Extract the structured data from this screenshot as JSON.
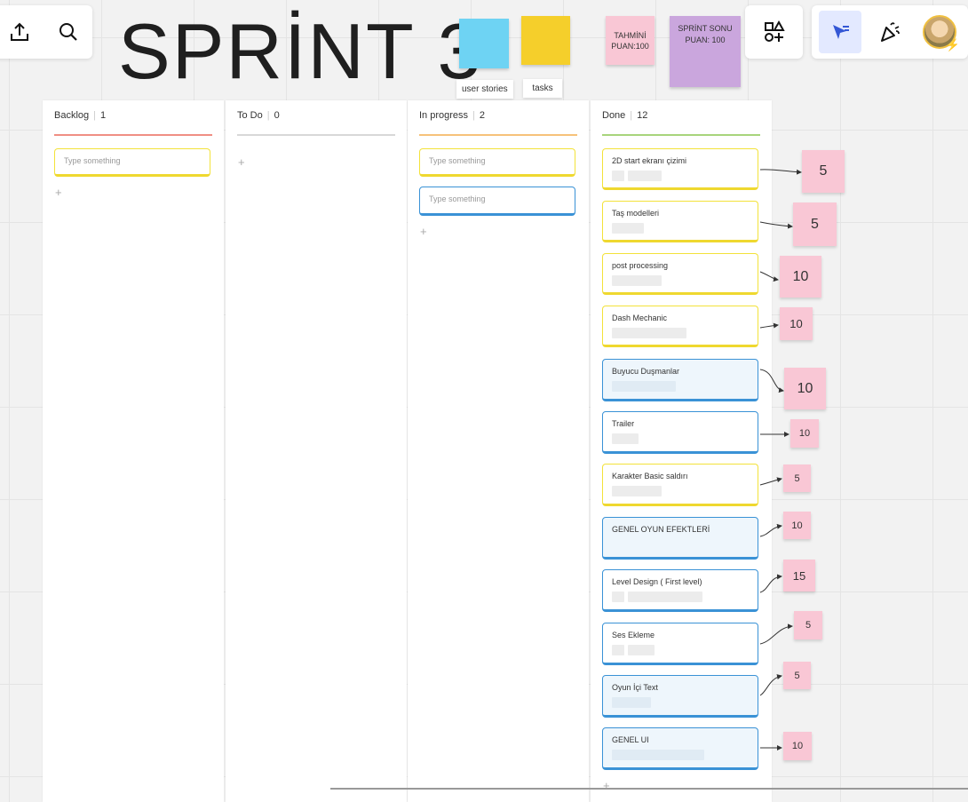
{
  "title": "SPRİNT 3",
  "legend": {
    "user_stories": "user stories",
    "tasks": "tasks"
  },
  "score_notes": {
    "estimated": "TAHMİNİ PUAN:100",
    "sprint_end": "SPRİNT SONU PUAN: 100"
  },
  "columns": [
    {
      "name": "Backlog",
      "count": "1",
      "cards": [
        {
          "title": "Type something"
        }
      ]
    },
    {
      "name": "To Do",
      "count": "0",
      "cards": []
    },
    {
      "name": "In progress",
      "count": "2",
      "cards": [
        {
          "title": "Type something"
        },
        {
          "title": "Type something"
        }
      ]
    },
    {
      "name": "Done",
      "count": "12",
      "cards": [
        {
          "title": "2D start ekranı çizimi",
          "points": "5"
        },
        {
          "title": "Taş modelleri",
          "points": "5"
        },
        {
          "title": "post processing",
          "points": "10"
        },
        {
          "title": "Dash Mechanic",
          "points": "10"
        },
        {
          "title": "Buyucu Duşmanlar",
          "points": "10"
        },
        {
          "title": "Trailer",
          "points": "10"
        },
        {
          "title": "Karakter Basic saldırı",
          "points": "5"
        },
        {
          "title": "GENEL OYUN EFEKTLERİ",
          "points": "10"
        },
        {
          "title": "Level Design ( First level)",
          "points": "15"
        },
        {
          "title": "Ses Ekleme",
          "points": "5"
        },
        {
          "title": "Oyun İçi Text",
          "points": "5"
        },
        {
          "title": "GENEL UI",
          "points": "10"
        }
      ]
    }
  ],
  "icons": {
    "toolbar_left": [
      "share-icon",
      "search-icon"
    ],
    "toolbar_mid": [
      "shapes-add-icon"
    ],
    "toolbar_right": [
      "select-cursor-icon",
      "celebrate-icon",
      "avatar"
    ]
  },
  "colors": {
    "backlog": "#f08f84",
    "todo": "#d8d8d8",
    "in_progress": "#f6c27a",
    "done": "#a8d47c",
    "sticky_blue": "#6ed3f3",
    "sticky_yellow": "#f5cf2b",
    "sticky_pink": "#f9c7d5",
    "sticky_purple": "#caa6dd",
    "card_yellow": "#efd82f",
    "card_blue": "#3a92d6"
  }
}
